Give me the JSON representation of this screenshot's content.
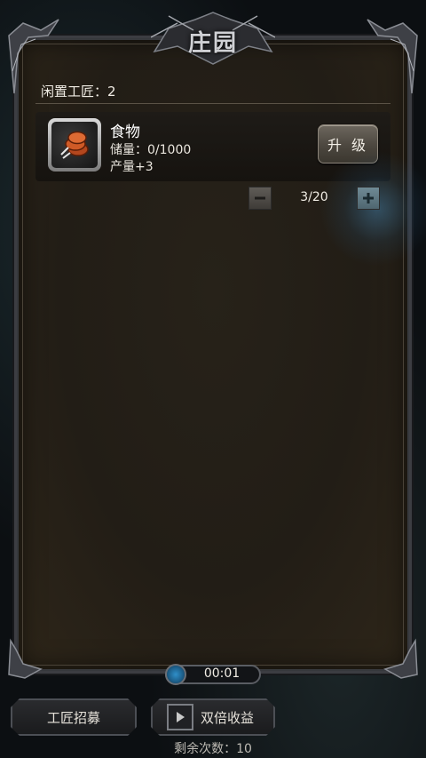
{
  "title": "庄园",
  "idle_craftsmen": "闲置工匠：2",
  "resource": {
    "icon": "food-icon",
    "name": "食物",
    "storage": "储量：0/1000",
    "output": "产量+3",
    "upgrade_label": "升 级"
  },
  "workers": {
    "value": "3/20",
    "minus": "minus-icon",
    "plus": "plus-icon"
  },
  "timer": {
    "value": "00:01"
  },
  "buttons": {
    "recruit": "工匠招募",
    "double": "双倍收益"
  },
  "remaining": "剩余次数：10",
  "colors": {
    "panel": "#241f18",
    "frame": "#3c3d42",
    "timer_accent": "#2f8fc9"
  }
}
